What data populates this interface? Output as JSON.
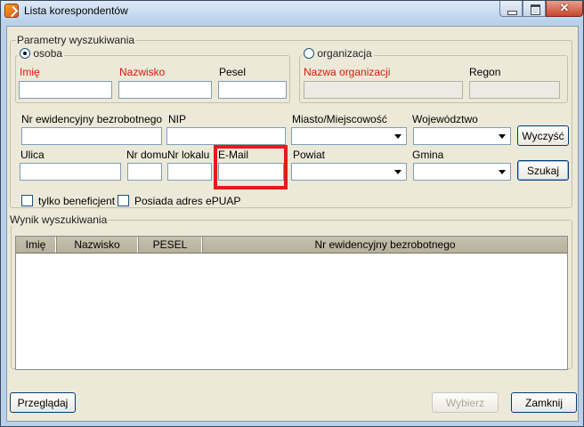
{
  "window": {
    "title": "Lista korespondentów",
    "close_glyph": "✕"
  },
  "search": {
    "group_title": "Parametry wyszukiwania",
    "radio_person": "osoba",
    "radio_org": "organizacja",
    "selected_mode": "osoba",
    "person": {
      "imie": "Imię",
      "nazwisko": "Nazwisko",
      "pesel": "Pesel"
    },
    "org": {
      "nazwa": "Nazwa organizacji",
      "regon": "Regon"
    },
    "labels": {
      "nr_ewid": "Nr ewidencyjny bezrobotnego",
      "nip": "NIP",
      "miasto": "Miasto/Miejscowość",
      "wojewodztwo": "Województwo",
      "ulica": "Ulica",
      "nr_domu": "Nr domu",
      "nr_lokalu": "Nr lokalu",
      "email": "E-Mail",
      "powiat": "Powiat",
      "gmina": "Gmina"
    },
    "values": {
      "imie": "",
      "nazwisko": "",
      "pesel": "",
      "nazwa": "",
      "regon": "",
      "nr_ewid": "",
      "nip": "",
      "ulica": "",
      "nr_domu": "",
      "nr_lokalu": "",
      "email": ""
    },
    "checkbox_beneficjent": "tylko beneficjent",
    "checkbox_epuap": "Posiada adres ePUAP",
    "btn_clear": "Wyczyść",
    "btn_search": "Szukaj"
  },
  "results": {
    "group_title": "Wynik wyszukiwania",
    "columns": [
      "Imię",
      "Nazwisko",
      "PESEL",
      "Nr ewidencyjny bezrobotnego"
    ]
  },
  "footer": {
    "btn_browse": "Przeglądaj",
    "btn_choose": "Wybierz",
    "btn_close": "Zamknij"
  },
  "colors": {
    "highlight": "#e41b1b",
    "required_label": "#e0180a"
  }
}
